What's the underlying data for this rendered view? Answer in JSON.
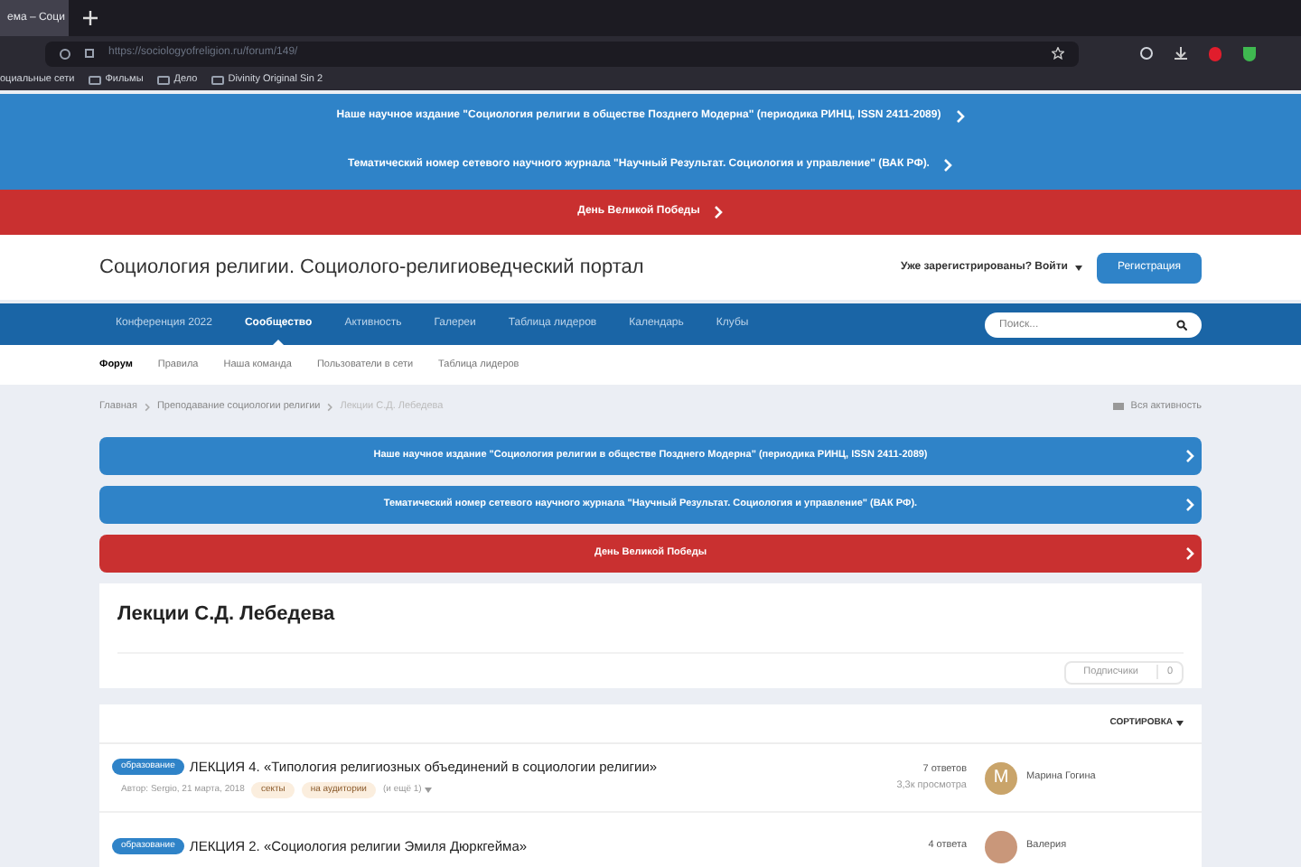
{
  "browser": {
    "tab_title": "ема – Соци",
    "url_host": "https://sociologyofreligion.ru",
    "url_path": "/forum/149/",
    "bookmarks": [
      "оциальные сети",
      "Фильмы",
      "Дело",
      "Divinity Original Sin 2"
    ]
  },
  "top_banners": [
    {
      "text": "Наше научное издание \"Социология религии в обществе Позднего Модерна\" (периодика РИНЦ, ISSN 2411-2089)",
      "kind": "blue"
    },
    {
      "text": "Тематический номер сетевого научного журнала \"Научный Результат. Социология и управление\" (ВАК РФ).",
      "kind": "blue"
    },
    {
      "text": "День Великой Победы",
      "kind": "red"
    }
  ],
  "header": {
    "site_title": "Социология религии. Социолого-религиоведческий портал",
    "sign_in": "Уже зарегистрированы? Войти",
    "register": "Регистрация"
  },
  "nav": {
    "items": [
      {
        "label": "Конференция 2022",
        "selected": false
      },
      {
        "label": "Сообщество",
        "selected": true
      },
      {
        "label": "Активность",
        "selected": false
      },
      {
        "label": "Галереи",
        "selected": false
      },
      {
        "label": "Таблица лидеров",
        "selected": false
      },
      {
        "label": "Календарь",
        "selected": false
      },
      {
        "label": "Клубы",
        "selected": false
      }
    ],
    "search_placeholder": "Поиск..."
  },
  "subnav": [
    {
      "label": "Форум",
      "selected": true
    },
    {
      "label": "Правила",
      "selected": false
    },
    {
      "label": "Наша команда",
      "selected": false
    },
    {
      "label": "Пользователи в сети",
      "selected": false
    },
    {
      "label": "Таблица лидеров",
      "selected": false
    }
  ],
  "breadcrumb": [
    "Главная",
    "Преподавание социологии религии",
    "Лекции С.Д. Лебедева"
  ],
  "all_activity": "Вся активность",
  "content_banners": [
    {
      "text": "Наше научное издание \"Социология религии в обществе Позднего Модерна\" (периодика РИНЦ, ISSN 2411-2089)",
      "kind": "blue"
    },
    {
      "text": "Тематический номер сетевого научного журнала \"Научный Результат. Социология и управление\" (ВАК РФ).",
      "kind": "blue"
    },
    {
      "text": "День Великой Победы",
      "kind": "red"
    }
  ],
  "forum": {
    "title": "Лекции С.Д. Лебедева",
    "followers_label": "Подписчики",
    "followers_count": "0"
  },
  "sort_label": "СОРТИРОВКА",
  "topics": [
    {
      "prefix": "образование",
      "title": "ЛЕКЦИЯ 4. «Типология религиозных объединений в социологии религии»",
      "meta": "Автор: Sergio, 21 марта, 2018",
      "tags": [
        "секты",
        "на аудитории"
      ],
      "more": "(и ещё 1)",
      "replies": "7 ответов",
      "views": "3,3к просмотра",
      "last_user": "Марина Гогина",
      "avatar_letter": "M"
    },
    {
      "prefix": "образование",
      "title": "ЛЕКЦИЯ 2. «Социология религии Эмиля Дюркгейма»",
      "replies": "4 ответа",
      "last_user": "Валерия"
    }
  ]
}
